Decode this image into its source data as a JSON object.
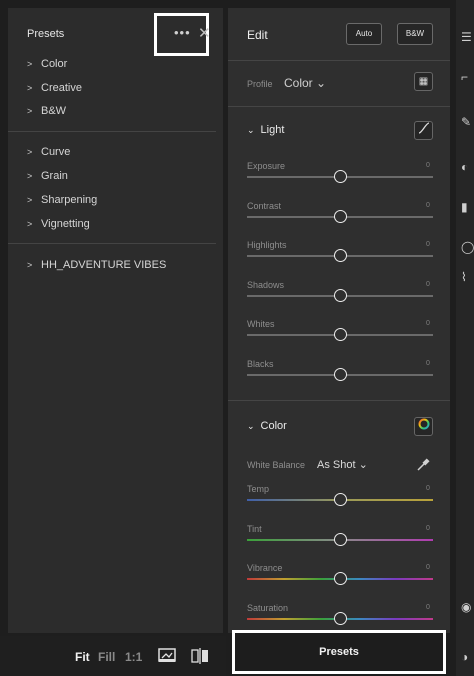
{
  "presets_panel": {
    "title": "Presets",
    "more_icon": "•••",
    "close_icon": "✕",
    "group1": [
      "Color",
      "Creative",
      "B&W"
    ],
    "group2": [
      "Curve",
      "Grain",
      "Sharpening",
      "Vignetting"
    ],
    "group3": [
      "HH_ADVENTURE VIBES"
    ]
  },
  "bottom_left": {
    "fit": "Fit",
    "fill": "Fill",
    "one_to_one": "1:1"
  },
  "edit_panel": {
    "title": "Edit",
    "auto_label": "Auto",
    "bw_label": "B&W",
    "profile_label": "Profile",
    "profile_value": "Color ⌄",
    "light": {
      "title": "Light",
      "sliders": [
        {
          "label": "Exposure",
          "value": "0",
          "position": 0.5
        },
        {
          "label": "Contrast",
          "value": "0",
          "position": 0.5
        },
        {
          "label": "Highlights",
          "value": "0",
          "position": 0.5
        },
        {
          "label": "Shadows",
          "value": "0",
          "position": 0.5
        },
        {
          "label": "Whites",
          "value": "0",
          "position": 0.5
        },
        {
          "label": "Blacks",
          "value": "0",
          "position": 0.5
        }
      ]
    },
    "color": {
      "title": "Color",
      "white_balance_label": "White Balance",
      "white_balance_value": "As Shot ⌄",
      "sliders": [
        {
          "label": "Temp",
          "value": "0",
          "position": 0.5
        },
        {
          "label": "Tint",
          "value": "0",
          "position": 0.5
        },
        {
          "label": "Vibrance",
          "value": "0",
          "position": 0.5
        },
        {
          "label": "Saturation",
          "value": "0",
          "position": 0.5
        }
      ]
    }
  },
  "presets_button": {
    "label": "Presets"
  }
}
